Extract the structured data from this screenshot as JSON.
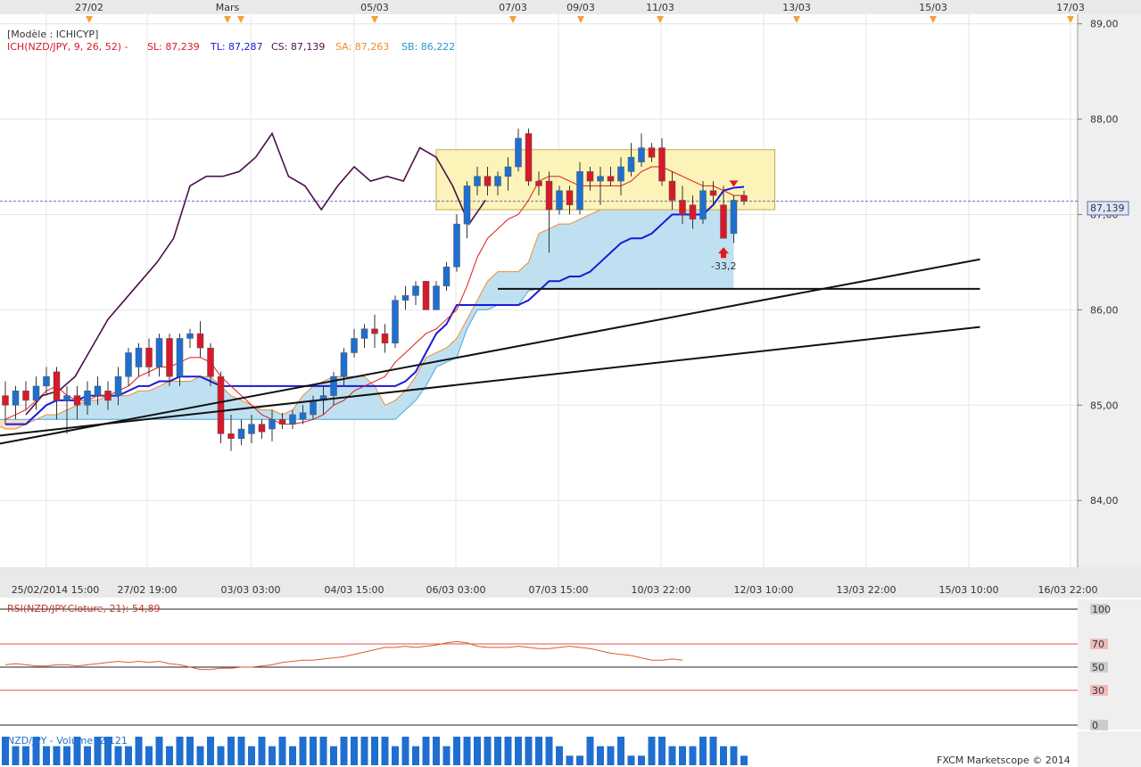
{
  "top_dates": [
    "27/02",
    "Mars",
    "05/03",
    "07/03",
    "09/03",
    "11/03",
    "13/03",
    "15/03",
    "17/03"
  ],
  "legend": {
    "model": "[Modèle : ICHICYP]",
    "ich": "ICH(NZD/JPY, 9, 26, 52) -",
    "sl": "SL: 87,239",
    "tl": "TL: 87,287",
    "cs": "CS: 87,139",
    "sa": "SA: 87,263",
    "sb": "SB: 86,222"
  },
  "price_axis": [
    "89,00",
    "88,00",
    "87,00",
    "86,00",
    "85,00",
    "84,00"
  ],
  "current_price_label": "87,139",
  "signal_label": "-33,2",
  "time_labels": [
    "25/02/2014 15:00",
    "27/02 19:00",
    "03/03 03:00",
    "04/03 15:00",
    "06/03 03:00",
    "07/03 15:00",
    "10/03 22:00",
    "12/03 10:00",
    "13/03 22:00",
    "15/03 10:00",
    "16/03 22:00"
  ],
  "rsi": {
    "label": "RSI(NZD/JPY.Cloture, 21): 54,89",
    "levels": [
      "100",
      "70",
      "50",
      "30",
      "0"
    ]
  },
  "volume": {
    "label": "NZD/JPY - Volume: 2 121"
  },
  "brand": "FXCM Marketscope © 2014",
  "colors": {
    "bull": "#1f6fd0",
    "bear": "#d8192a",
    "tenkan": "#e01b1b",
    "kijun": "#1a1ad6",
    "chikou": "#4b0f4a",
    "cloud_bull": "#bfe0f1",
    "cloud_bear": "#f8dfc6",
    "senkou_a": "#f08a2e",
    "senkou_b": "#49a8d8",
    "rsi": "#d4602a",
    "volume": "#1f6fd0",
    "box": "#fbf3b8"
  },
  "chart_data": {
    "type": "candlestick",
    "ylim": [
      83.3,
      89.1
    ],
    "candles": [
      {
        "o": 85.1,
        "h": 85.25,
        "l": 84.8,
        "c": 85.0
      },
      {
        "o": 85.0,
        "h": 85.2,
        "l": 84.85,
        "c": 85.15
      },
      {
        "o": 85.15,
        "h": 85.25,
        "l": 84.95,
        "c": 85.05
      },
      {
        "o": 85.05,
        "h": 85.3,
        "l": 84.95,
        "c": 85.2
      },
      {
        "o": 85.2,
        "h": 85.4,
        "l": 85.1,
        "c": 85.3
      },
      {
        "o": 85.35,
        "h": 85.4,
        "l": 84.85,
        "c": 85.05
      },
      {
        "o": 85.05,
        "h": 85.2,
        "l": 84.7,
        "c": 85.1
      },
      {
        "o": 85.1,
        "h": 85.2,
        "l": 84.85,
        "c": 85.0
      },
      {
        "o": 85.0,
        "h": 85.25,
        "l": 84.9,
        "c": 85.15
      },
      {
        "o": 85.1,
        "h": 85.3,
        "l": 85.0,
        "c": 85.2
      },
      {
        "o": 85.15,
        "h": 85.25,
        "l": 84.95,
        "c": 85.05
      },
      {
        "o": 85.1,
        "h": 85.4,
        "l": 85.0,
        "c": 85.3
      },
      {
        "o": 85.3,
        "h": 85.6,
        "l": 85.2,
        "c": 85.55
      },
      {
        "o": 85.4,
        "h": 85.65,
        "l": 85.3,
        "c": 85.6
      },
      {
        "o": 85.6,
        "h": 85.7,
        "l": 85.3,
        "c": 85.4
      },
      {
        "o": 85.4,
        "h": 85.75,
        "l": 85.3,
        "c": 85.7
      },
      {
        "o": 85.7,
        "h": 85.75,
        "l": 85.2,
        "c": 85.3
      },
      {
        "o": 85.3,
        "h": 85.75,
        "l": 85.2,
        "c": 85.7
      },
      {
        "o": 85.7,
        "h": 85.8,
        "l": 85.6,
        "c": 85.75
      },
      {
        "o": 85.75,
        "h": 85.88,
        "l": 85.5,
        "c": 85.6
      },
      {
        "o": 85.6,
        "h": 85.65,
        "l": 85.2,
        "c": 85.3
      },
      {
        "o": 85.3,
        "h": 85.35,
        "l": 84.6,
        "c": 84.7
      },
      {
        "o": 84.7,
        "h": 84.9,
        "l": 84.52,
        "c": 84.65
      },
      {
        "o": 84.65,
        "h": 84.85,
        "l": 84.58,
        "c": 84.75
      },
      {
        "o": 84.7,
        "h": 84.9,
        "l": 84.6,
        "c": 84.8
      },
      {
        "o": 84.8,
        "h": 84.85,
        "l": 84.65,
        "c": 84.72
      },
      {
        "o": 84.75,
        "h": 84.95,
        "l": 84.62,
        "c": 84.85
      },
      {
        "o": 84.85,
        "h": 84.92,
        "l": 84.75,
        "c": 84.8
      },
      {
        "o": 84.8,
        "h": 84.95,
        "l": 84.75,
        "c": 84.9
      },
      {
        "o": 84.85,
        "h": 85.0,
        "l": 84.8,
        "c": 84.92
      },
      {
        "o": 84.9,
        "h": 85.1,
        "l": 84.85,
        "c": 85.05
      },
      {
        "o": 85.05,
        "h": 85.2,
        "l": 84.9,
        "c": 85.1
      },
      {
        "o": 85.1,
        "h": 85.35,
        "l": 85.0,
        "c": 85.3
      },
      {
        "o": 85.3,
        "h": 85.6,
        "l": 85.2,
        "c": 85.55
      },
      {
        "o": 85.55,
        "h": 85.8,
        "l": 85.5,
        "c": 85.7
      },
      {
        "o": 85.7,
        "h": 85.85,
        "l": 85.6,
        "c": 85.8
      },
      {
        "o": 85.8,
        "h": 85.95,
        "l": 85.6,
        "c": 85.75
      },
      {
        "o": 85.75,
        "h": 85.85,
        "l": 85.55,
        "c": 85.65
      },
      {
        "o": 85.65,
        "h": 86.15,
        "l": 85.6,
        "c": 86.1
      },
      {
        "o": 86.1,
        "h": 86.25,
        "l": 86.0,
        "c": 86.15
      },
      {
        "o": 86.15,
        "h": 86.3,
        "l": 86.05,
        "c": 86.25
      },
      {
        "o": 86.3,
        "h": 86.3,
        "l": 86.0,
        "c": 86.0
      },
      {
        "o": 86.0,
        "h": 86.3,
        "l": 86.0,
        "c": 86.25
      },
      {
        "o": 86.25,
        "h": 86.5,
        "l": 86.2,
        "c": 86.45
      },
      {
        "o": 86.45,
        "h": 87.0,
        "l": 86.4,
        "c": 86.9
      },
      {
        "o": 86.9,
        "h": 87.35,
        "l": 86.75,
        "c": 87.3
      },
      {
        "o": 87.3,
        "h": 87.5,
        "l": 87.2,
        "c": 87.4
      },
      {
        "o": 87.4,
        "h": 87.5,
        "l": 87.2,
        "c": 87.3
      },
      {
        "o": 87.3,
        "h": 87.45,
        "l": 87.2,
        "c": 87.4
      },
      {
        "o": 87.4,
        "h": 87.6,
        "l": 87.25,
        "c": 87.5
      },
      {
        "o": 87.5,
        "h": 87.9,
        "l": 87.45,
        "c": 87.8
      },
      {
        "o": 87.85,
        "h": 87.9,
        "l": 87.3,
        "c": 87.35
      },
      {
        "o": 87.35,
        "h": 87.45,
        "l": 87.2,
        "c": 87.3
      },
      {
        "o": 87.35,
        "h": 87.45,
        "l": 86.6,
        "c": 87.05
      },
      {
        "o": 87.05,
        "h": 87.3,
        "l": 87.0,
        "c": 87.25
      },
      {
        "o": 87.25,
        "h": 87.3,
        "l": 87.0,
        "c": 87.1
      },
      {
        "o": 87.05,
        "h": 87.55,
        "l": 87.0,
        "c": 87.45
      },
      {
        "o": 87.45,
        "h": 87.5,
        "l": 87.25,
        "c": 87.35
      },
      {
        "o": 87.35,
        "h": 87.5,
        "l": 87.1,
        "c": 87.4
      },
      {
        "o": 87.4,
        "h": 87.5,
        "l": 87.3,
        "c": 87.35
      },
      {
        "o": 87.35,
        "h": 87.6,
        "l": 87.2,
        "c": 87.5
      },
      {
        "o": 87.45,
        "h": 87.75,
        "l": 87.4,
        "c": 87.6
      },
      {
        "o": 87.55,
        "h": 87.85,
        "l": 87.5,
        "c": 87.7
      },
      {
        "o": 87.7,
        "h": 87.75,
        "l": 87.55,
        "c": 87.6
      },
      {
        "o": 87.7,
        "h": 87.8,
        "l": 87.3,
        "c": 87.35
      },
      {
        "o": 87.35,
        "h": 87.45,
        "l": 87.05,
        "c": 87.15
      },
      {
        "o": 87.15,
        "h": 87.3,
        "l": 86.9,
        "c": 87.0
      },
      {
        "o": 87.1,
        "h": 87.2,
        "l": 86.85,
        "c": 86.95
      },
      {
        "o": 86.95,
        "h": 87.35,
        "l": 86.9,
        "c": 87.25
      },
      {
        "o": 87.25,
        "h": 87.35,
        "l": 87.1,
        "c": 87.2
      },
      {
        "o": 87.1,
        "h": 87.3,
        "l": 86.75,
        "c": 86.75
      },
      {
        "o": 86.8,
        "h": 87.2,
        "l": 86.7,
        "c": 87.15
      },
      {
        "o": 87.2,
        "h": 87.25,
        "l": 87.1,
        "c": 87.14
      }
    ],
    "tenkan": [
      84.85,
      84.9,
      84.95,
      85.05,
      85.15,
      85.2,
      85.1,
      85.05,
      85.05,
      85.1,
      85.1,
      85.15,
      85.2,
      85.3,
      85.35,
      85.4,
      85.4,
      85.45,
      85.5,
      85.5,
      85.45,
      85.3,
      85.2,
      85.1,
      85.0,
      84.9,
      84.85,
      84.8,
      84.8,
      84.82,
      84.85,
      84.9,
      85.0,
      85.05,
      85.15,
      85.2,
      85.25,
      85.3,
      85.45,
      85.55,
      85.65,
      85.75,
      85.8,
      85.9,
      86.0,
      86.25,
      86.55,
      86.75,
      86.85,
      86.95,
      87.0,
      87.15,
      87.35,
      87.4,
      87.4,
      87.35,
      87.3,
      87.3,
      87.3,
      87.3,
      87.3,
      87.35,
      87.45,
      87.5,
      87.5,
      87.45,
      87.4,
      87.35,
      87.3,
      87.3,
      87.25,
      87.2,
      87.2
    ],
    "kijun": [
      84.8,
      84.8,
      84.8,
      84.9,
      85.0,
      85.05,
      85.05,
      85.05,
      85.1,
      85.1,
      85.1,
      85.1,
      85.15,
      85.2,
      85.2,
      85.25,
      85.25,
      85.3,
      85.3,
      85.3,
      85.25,
      85.2,
      85.2,
      85.2,
      85.2,
      85.2,
      85.2,
      85.2,
      85.2,
      85.2,
      85.2,
      85.2,
      85.2,
      85.2,
      85.2,
      85.2,
      85.2,
      85.2,
      85.2,
      85.25,
      85.35,
      85.55,
      85.75,
      85.85,
      86.05,
      86.05,
      86.05,
      86.05,
      86.05,
      86.05,
      86.05,
      86.1,
      86.2,
      86.3,
      86.3,
      86.35,
      86.35,
      86.4,
      86.5,
      86.6,
      86.7,
      86.75,
      86.75,
      86.8,
      86.9,
      87.0,
      87.0,
      87.0,
      87.0,
      87.1,
      87.25,
      87.28,
      87.29
    ],
    "chikou": [
      84.9,
      85.1,
      85.15,
      85.3,
      85.6,
      85.9,
      86.1,
      86.3,
      86.5,
      86.75,
      87.3,
      87.4,
      87.4,
      87.45,
      87.6,
      87.85,
      87.4,
      87.3,
      87.05,
      87.3,
      87.5,
      87.35,
      87.4,
      87.35,
      87.7,
      87.6,
      87.3,
      86.9,
      87.15
    ],
    "senkou_a": [
      84.8,
      84.75,
      84.75,
      84.8,
      84.85,
      84.9,
      84.9,
      84.95,
      85.0,
      85.05,
      85.05,
      85.1,
      85.1,
      85.1,
      85.15,
      85.15,
      85.2,
      85.25,
      85.25,
      85.25,
      85.3,
      85.3,
      85.2,
      85.1,
      85.05,
      85.0,
      84.95,
      84.95,
      84.9,
      84.95,
      85.1,
      85.2,
      85.25,
      85.3,
      85.3,
      85.3,
      85.3,
      85.2,
      85.0,
      85.05,
      85.15,
      85.3,
      85.5,
      85.55,
      85.6,
      85.7,
      85.9,
      86.1,
      86.3,
      86.4,
      86.4,
      86.4,
      86.5,
      86.8,
      86.85,
      86.9,
      86.9,
      86.95,
      87.0,
      87.05,
      87.1,
      87.05,
      87.2,
      87.25,
      87.25,
      87.25,
      87.2,
      87.2,
      87.2,
      87.2,
      87.2,
      87.25,
      87.27
    ],
    "senkou_b": [
      84.85,
      84.85,
      84.85,
      84.85,
      84.85,
      84.85,
      84.85,
      84.85,
      84.85,
      84.85,
      84.85,
      84.85,
      84.85,
      84.85,
      84.85,
      84.85,
      84.85,
      84.85,
      84.85,
      84.85,
      84.85,
      84.85,
      84.85,
      84.85,
      84.85,
      84.85,
      84.85,
      84.85,
      84.85,
      84.85,
      84.85,
      84.85,
      84.85,
      84.85,
      84.85,
      84.85,
      84.85,
      84.85,
      84.85,
      84.85,
      84.95,
      85.05,
      85.2,
      85.4,
      85.45,
      85.5,
      85.8,
      86.0,
      86.0,
      86.05,
      86.05,
      86.05,
      86.2,
      86.22,
      86.22,
      86.22,
      86.22,
      86.22,
      86.22,
      86.22,
      86.22,
      86.22,
      86.22,
      86.22,
      86.22,
      86.22,
      86.22,
      86.22,
      86.22,
      86.22,
      86.22,
      86.22,
      86.22
    ],
    "cloud_offset": -26,
    "support": [
      {
        "i1": 48,
        "i2": 95,
        "v1": 86.22,
        "v2": 86.22
      },
      {
        "i1": -30,
        "i2": 95,
        "v1": 84.0,
        "v2": 86.53
      },
      {
        "i1": -30,
        "i2": 95,
        "v1": 84.33,
        "v2": 85.82
      }
    ],
    "box": {
      "i1": 42,
      "i2": 75,
      "v1": 87.05,
      "v2": 87.68
    },
    "current_price": 87.139,
    "signal_candle": 70,
    "rsi_values": [
      52,
      53,
      52,
      51,
      51,
      52,
      52,
      51,
      52,
      53,
      54,
      55,
      54,
      55,
      54,
      55,
      53,
      52,
      50,
      48,
      48,
      49,
      49,
      50,
      50,
      51,
      52,
      54,
      55,
      56,
      56,
      57,
      58,
      59,
      61,
      63,
      65,
      67,
      67,
      68,
      67,
      68,
      69,
      71,
      72,
      71,
      68,
      67,
      67,
      67,
      68,
      67,
      66,
      66,
      67,
      68,
      67,
      66,
      64,
      62,
      61,
      60,
      58,
      56,
      56,
      57,
      56
    ],
    "volume_values": [
      3,
      2,
      2,
      3,
      2,
      2,
      2,
      3,
      2,
      3,
      3,
      2,
      2,
      3,
      2,
      3,
      2,
      3,
      3,
      2,
      3,
      2,
      3,
      3,
      2,
      3,
      2,
      3,
      2,
      3,
      3,
      3,
      2,
      3,
      3,
      3,
      3,
      3,
      2,
      3,
      2,
      3,
      3,
      2,
      3,
      3,
      3,
      3,
      3,
      3,
      3,
      3,
      3,
      3,
      2,
      1,
      1,
      3,
      2,
      2,
      3,
      1,
      1,
      3,
      3,
      2,
      2,
      2,
      3,
      3,
      2,
      2,
      1
    ]
  }
}
